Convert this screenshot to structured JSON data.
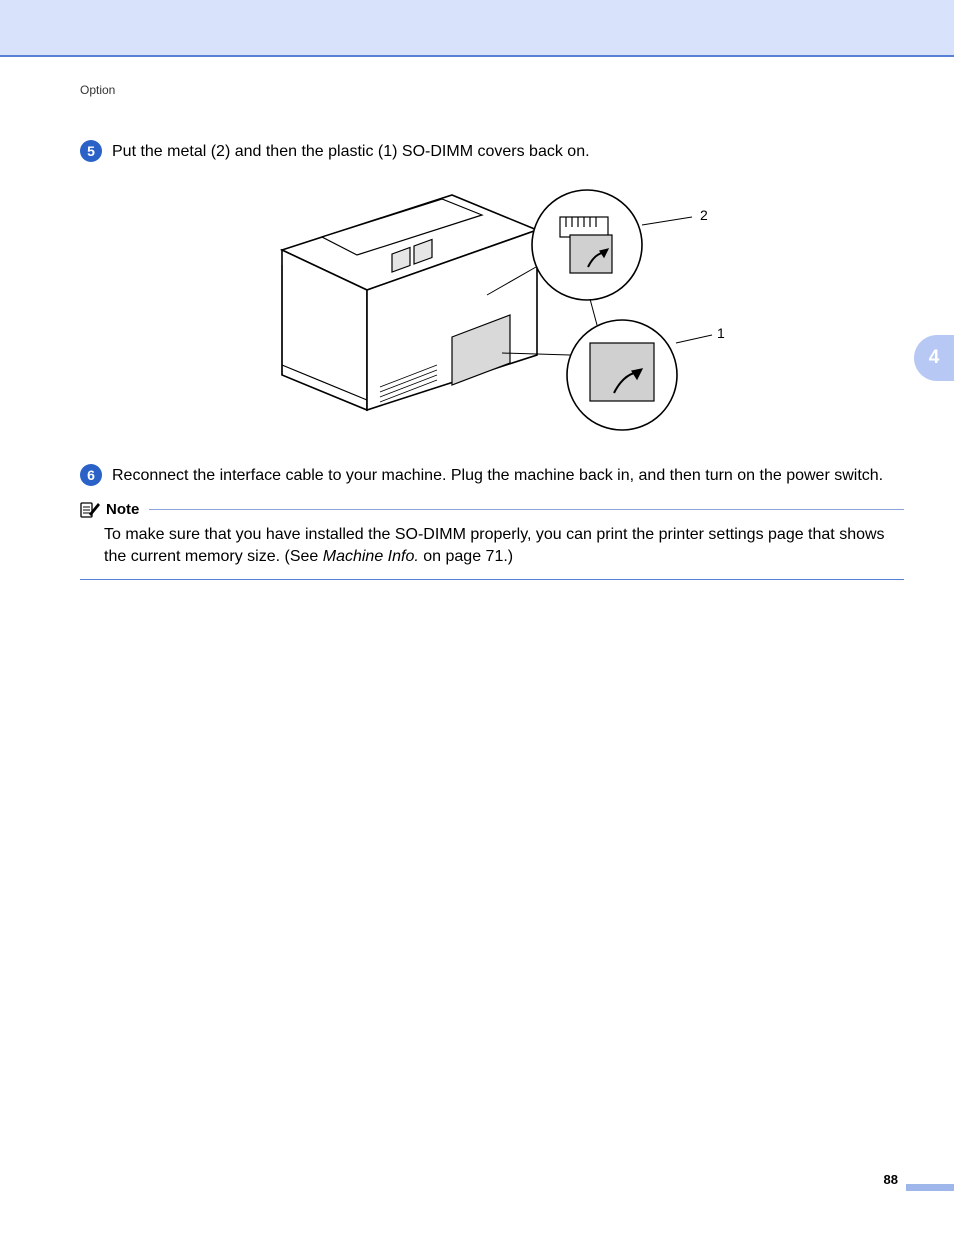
{
  "header": {
    "section_label": "Option"
  },
  "chapter_tab": "4",
  "steps": [
    {
      "num": "5",
      "text": "Put the metal (2) and then the plastic (1) SO-DIMM covers back on."
    },
    {
      "num": "6",
      "text": "Reconnect the interface cable to your machine. Plug the machine back in, and then turn on the power switch."
    }
  ],
  "figure": {
    "callouts": {
      "top": "2",
      "bottom": "1"
    }
  },
  "note": {
    "label": "Note",
    "body_before": "To make sure that you have installed the SO-DIMM properly, you can print the printer settings page that shows the current memory size. (See ",
    "body_italic": "Machine Info.",
    "body_after": " on page 71.)"
  },
  "page_number": "88"
}
